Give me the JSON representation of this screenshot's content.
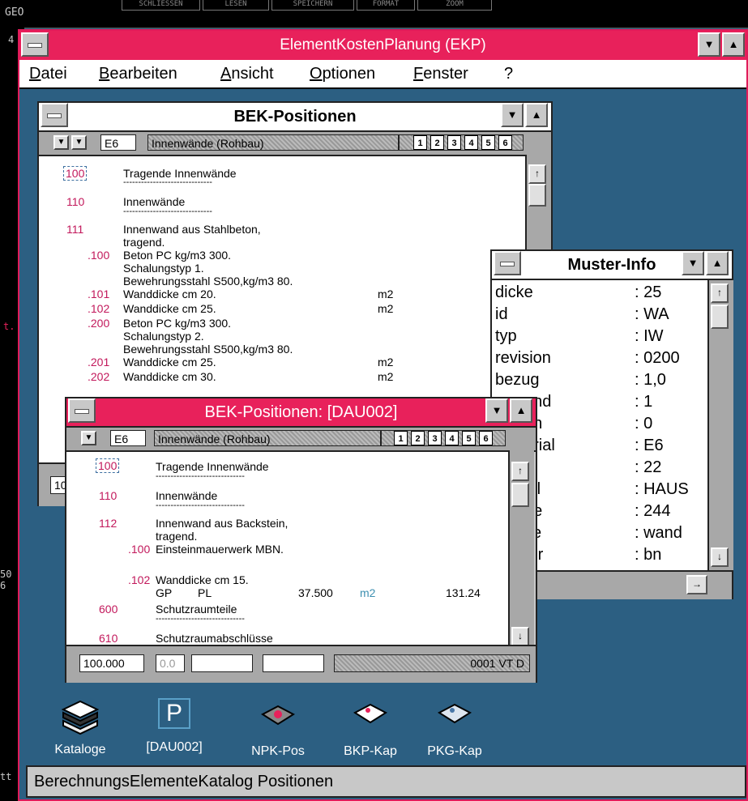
{
  "console": {
    "label": "GEO",
    "buttons": [
      "SCHLIESSEN",
      "LESEN",
      "SPEICHERN",
      "FORMAT",
      "ZOOM"
    ],
    "left_marks": [
      "4",
      "t.",
      "50",
      "6",
      "tt"
    ]
  },
  "app": {
    "title": "ElementKostenPlanung (EKP)",
    "menu": [
      "Datei",
      "Bearbeiten",
      "Ansicht",
      "Optionen",
      "Fenster",
      "?"
    ],
    "status_bar": "BerechnungsElementeKatalog Positionen"
  },
  "bek_back": {
    "title": "BEK-Positionen",
    "code": "E6",
    "group": "Innenwände (Rohbau)",
    "pages": [
      "1",
      "2",
      "3",
      "4",
      "5",
      "6"
    ],
    "status_first": "10",
    "rows": [
      {
        "num": "100",
        "text": "Tragende Innenwände",
        "unit": ""
      },
      {
        "num": "",
        "text": "------------------------------",
        "unit": ""
      },
      {
        "num": "110",
        "text": "Innenwände",
        "unit": ""
      },
      {
        "num": "",
        "text": "------------------------------",
        "unit": ""
      },
      {
        "num": "111",
        "text": "Innenwand aus Stahlbeton,",
        "unit": ""
      },
      {
        "num": "",
        "text": "tragend.",
        "unit": ""
      },
      {
        "num": ".100",
        "text": "Beton PC kg/m3 300.",
        "unit": ""
      },
      {
        "num": "",
        "text": "Schalungstyp 1.",
        "unit": ""
      },
      {
        "num": "",
        "text": "Bewehrungsstahl S500,kg/m3 80.",
        "unit": ""
      },
      {
        "num": ".101",
        "text": "Wanddicke cm 20.",
        "unit": "m2"
      },
      {
        "num": ".102",
        "text": "Wanddicke cm 25.",
        "unit": "m2"
      },
      {
        "num": ".200",
        "text": "Beton PC kg/m3 300.",
        "unit": ""
      },
      {
        "num": "",
        "text": "Schalungstyp 2.",
        "unit": ""
      },
      {
        "num": "",
        "text": "Bewehrungsstahl S500,kg/m3 80.",
        "unit": ""
      },
      {
        "num": ".201",
        "text": "Wanddicke cm 25.",
        "unit": "m2"
      },
      {
        "num": ".202",
        "text": "Wanddicke cm 30.",
        "unit": "m2"
      }
    ]
  },
  "muster": {
    "title": "Muster-Info",
    "rows": [
      {
        "key": "dicke",
        "val": ": 25"
      },
      {
        "key": "id",
        "val": ": WA"
      },
      {
        "key": "typ",
        "val": ": IW"
      },
      {
        "key": "revision",
        "val": ": 0200"
      },
      {
        "key": "bezug",
        "val": ": 1,0"
      },
      {
        "key": "end",
        "val": ": 1"
      },
      {
        "key": "en",
        "val": ": 0"
      },
      {
        "key": "erial",
        "val": ": E6"
      },
      {
        "key": "",
        "val": ": 22"
      },
      {
        "key": "eil",
        "val": ": HAUS"
      },
      {
        "key": "ne",
        "val": ": 244"
      },
      {
        "key": "se",
        "val": ": wand"
      },
      {
        "key": "ter",
        "val": ": bn"
      }
    ]
  },
  "bek_front": {
    "title": "BEK-Positionen: [DAU002]",
    "code": "E6",
    "group": "Innenwände (Rohbau)",
    "pages": [
      "1",
      "2",
      "3",
      "4",
      "5",
      "6"
    ],
    "rows": [
      {
        "num": "100",
        "text": "Tragende Innenwände"
      },
      {
        "num": "",
        "text": "------------------------------"
      },
      {
        "num": "110",
        "text": "Innenwände"
      },
      {
        "num": "",
        "text": "------------------------------"
      },
      {
        "num": "112",
        "text": "Innenwand aus Backstein,"
      },
      {
        "num": "",
        "text": "tragend."
      },
      {
        "num": ".100",
        "text": "Einsteinmauerwerk MBN."
      },
      {
        "num": ".102",
        "text": "Wanddicke cm 15."
      },
      {
        "num": "600",
        "text": "Schutzraumteile"
      },
      {
        "num": "",
        "text": "------------------------------"
      },
      {
        "num": "610",
        "text": "Schutzraumabschlüsse"
      }
    ],
    "detail": {
      "gp": "GP",
      "pl": "PL",
      "qty": "37.500",
      "unit": "m2",
      "price": "131.24"
    },
    "status": {
      "amount": "100.000",
      "zero": "0.0",
      "code": "0001 VT D"
    }
  },
  "icons": [
    {
      "label": "Kataloge",
      "name": "kataloge-icon"
    },
    {
      "label": "[DAU002]",
      "name": "dau002-icon",
      "glyph": "P"
    },
    {
      "label": "NPK-Pos",
      "name": "npk-pos-icon"
    },
    {
      "label": "BKP-Kap",
      "name": "bkp-kap-icon"
    },
    {
      "label": "PKG-Kap",
      "name": "pkg-kap-icon"
    }
  ]
}
